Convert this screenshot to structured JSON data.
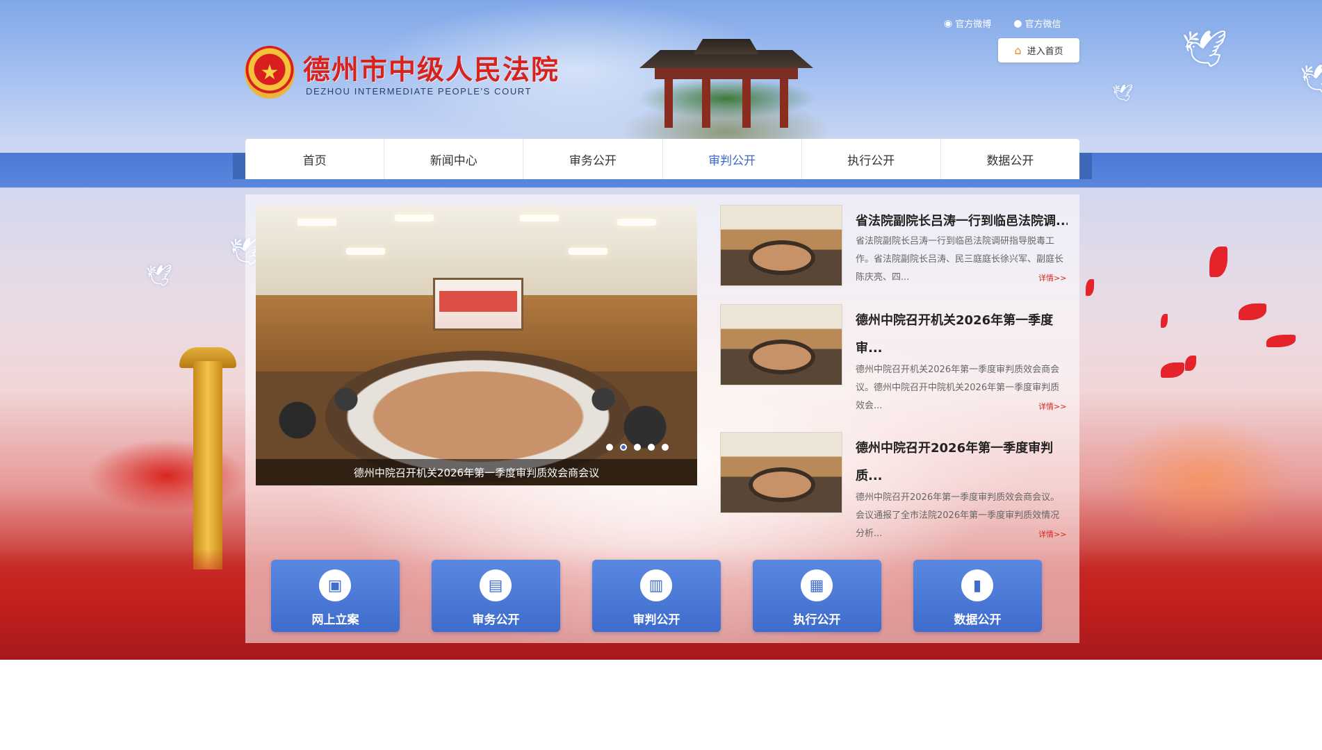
{
  "header": {
    "court_name_cn": "德州市中级人民法院",
    "court_name_en": "DEZHOU INTERMEDIATE PEOPLE'S COURT",
    "social_links": [
      {
        "label": "官方微博",
        "icon": "weibo-icon"
      },
      {
        "label": "官方微信",
        "icon": "wechat-icon"
      }
    ],
    "home_button_label": "进入首页"
  },
  "nav": {
    "items": [
      {
        "label": "首页"
      },
      {
        "label": "新闻中心"
      },
      {
        "label": "审务公开"
      },
      {
        "label": "审判公开",
        "active": true
      },
      {
        "label": "执行公开"
      },
      {
        "label": "数据公开"
      }
    ]
  },
  "carousel": {
    "caption": "德州中院召开机关2026年第一季度审判质效会商会议",
    "slide_count": 5,
    "active_slide": 2
  },
  "news": [
    {
      "title": "省法院副院长吕涛一行到临邑法院调...",
      "summary": "省法院副院长吕涛一行到临邑法院调研指导脱毒工作。省法院副院长吕涛、民三庭庭长徐兴军、副庭长陈庆亮、四...",
      "more": "详情>>"
    },
    {
      "title": "德州中院召开机关2026年第一季度审...",
      "summary": "德州中院召开机关2026年第一季度审判质效会商会议。德州中院召开中院机关2026年第一季度审判质效会...",
      "more": "详情>>"
    },
    {
      "title": "德州中院召开2026年第一季度审判质...",
      "summary": "德州中院召开2026年第一季度审判质效会商会议。会议通报了全市法院2026年第一季度审判质效情况分析...",
      "more": "详情>>"
    }
  ],
  "quick_links": [
    {
      "label": "网上立案",
      "icon": "monitor-icon"
    },
    {
      "label": "审务公开",
      "icon": "document-icon"
    },
    {
      "label": "审判公开",
      "icon": "gavel-document-icon"
    },
    {
      "label": "执行公开",
      "icon": "calendar-search-icon"
    },
    {
      "label": "数据公开",
      "icon": "bar-chart-icon"
    }
  ],
  "colors": {
    "brand_red": "#d9221c",
    "nav_active": "#3a67c8",
    "quick_link_blue": "#4a78d6"
  }
}
